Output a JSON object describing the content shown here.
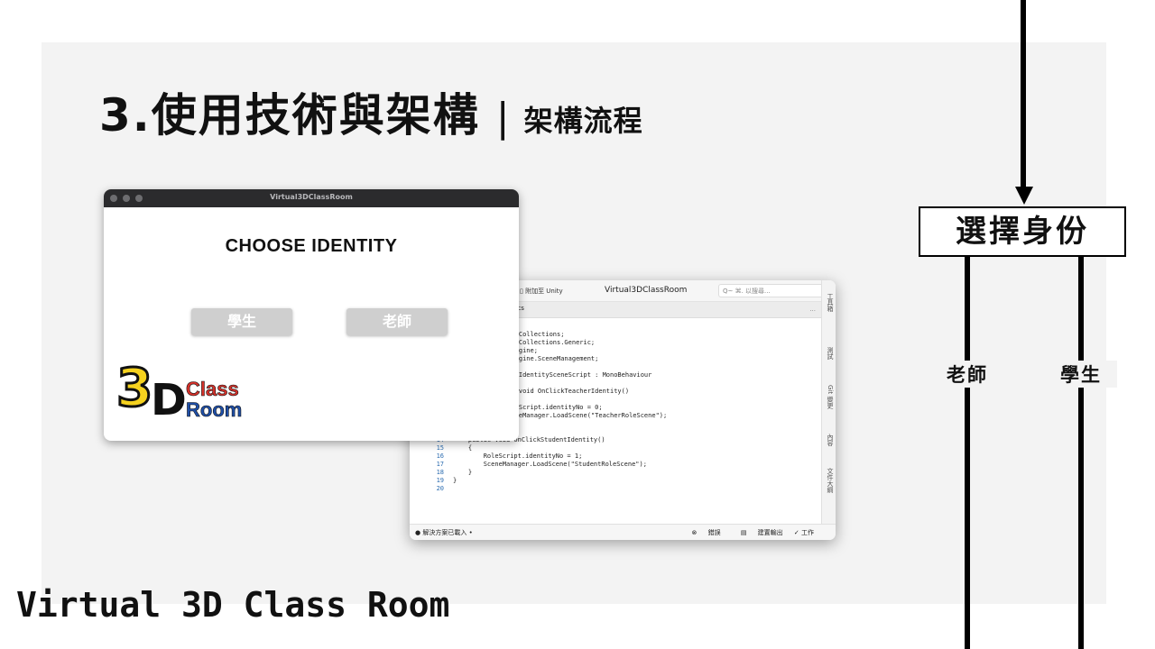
{
  "slide": {
    "title": "3.使用技術與架構",
    "separator": "|",
    "subtitle": "架構流程",
    "brand_text": "Virtual 3D Class Room"
  },
  "game_window": {
    "window_title": "Virtual3DClassRoom",
    "heading": "CHOOSE  IDENTITY",
    "student_button": "學生",
    "teacher_button": "老師",
    "logo": {
      "digit": "3",
      "letter": "D",
      "word1": "Class",
      "word2": "Room"
    }
  },
  "ide": {
    "attach_label": "附加至 Unity",
    "window_title": "Virtual3DClassRoom",
    "search_placeholder": "Q~ ⌘. 以搜尋...",
    "tab_label": "pt.cs",
    "tab_more": "...",
    "side_panel": [
      "工具箱",
      "測試",
      "Git 變更",
      "內容",
      "文件大綱"
    ],
    "code_lines": [
      {
        "no": "",
        "text": "tem.Collections;"
      },
      {
        "no": "",
        "text": "tem.Collections.Generic;"
      },
      {
        "no": "",
        "text": "tyEngine;"
      },
      {
        "no": "",
        "text": "tyEngine.SceneManagement;"
      },
      {
        "no": "",
        "text": ""
      },
      {
        "no": "",
        "text": "ass IdentitySceneScript : MonoBehaviour"
      },
      {
        "no": "",
        "text": ""
      },
      {
        "no": "",
        "text": "lic void OnClickTeacherIdentity()"
      },
      {
        "no": "",
        "text": ""
      },
      {
        "no": "",
        "text": "RoleScript.identityNo = 0;"
      },
      {
        "no": "",
        "text": "SceneManager.LoadScene(\"TeacherRoleScene\");"
      },
      {
        "no": "",
        "text": ""
      },
      {
        "no": "",
        "text": ""
      },
      {
        "no": "14",
        "text": "    public void OnClickStudentIdentity()"
      },
      {
        "no": "15",
        "text": "    {"
      },
      {
        "no": "16",
        "text": "        RoleScript.identityNo = 1;"
      },
      {
        "no": "17",
        "text": "        SceneManager.LoadScene(\"StudentRoleScene\");"
      },
      {
        "no": "18",
        "text": "    }"
      },
      {
        "no": "19",
        "text": "}"
      },
      {
        "no": "20",
        "text": ""
      }
    ],
    "status_left": "解決方案已載入 •",
    "status_errors": "錯誤",
    "status_build": "建置輸出",
    "status_work": "✓ 工作"
  },
  "flow": {
    "select_identity": "選擇身份",
    "teacher_label": "老師",
    "student_label": "學生"
  },
  "colors": {
    "panel_bg": "#f3f3f3",
    "button_bg": "#cfcfcf",
    "logo_yellow": "#f5d21f",
    "logo_blue": "#1f4fa8",
    "logo_red": "#d6322b"
  }
}
